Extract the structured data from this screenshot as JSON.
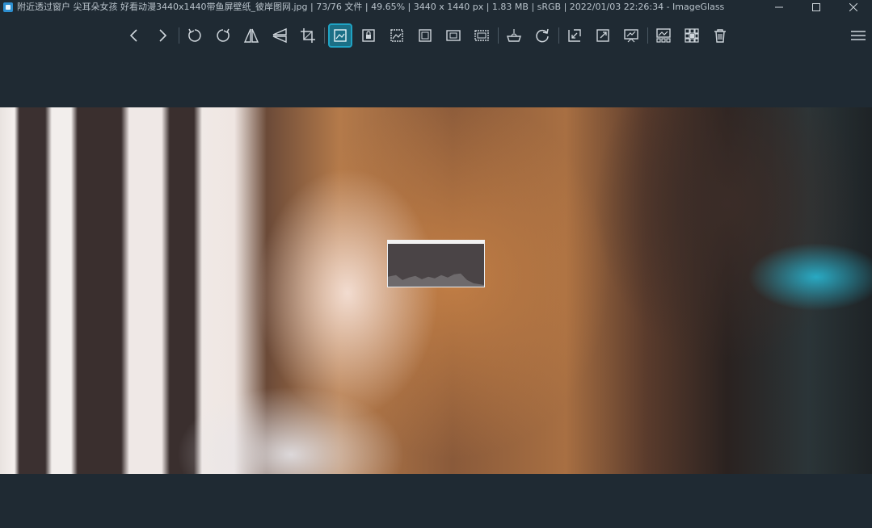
{
  "titlebar": {
    "title": "附近透过窗户 尖耳朵女孩 好看动漫3440x1440带鱼屏壁纸_彼岸图网.jpg  |  73/76 文件  |  49.65%  |  3440 x 1440 px  |  1.83 MB  |  sRGB  |  2022/01/03 22:26:34  - ImageGlass"
  },
  "toolbar": {
    "buttons": [
      {
        "name": "previous-image-button",
        "icon": "chevron-left-icon"
      },
      {
        "name": "next-image-button",
        "icon": "chevron-right-icon"
      },
      {
        "name": "rotate-left-button",
        "icon": "rotate-left-icon"
      },
      {
        "name": "rotate-right-button",
        "icon": "rotate-right-icon"
      },
      {
        "name": "flip-horizontal-button",
        "icon": "flip-horizontal-icon"
      },
      {
        "name": "flip-vertical-button",
        "icon": "flip-vertical-icon"
      },
      {
        "name": "crop-button",
        "icon": "crop-icon"
      },
      {
        "name": "auto-zoom-button",
        "icon": "auto-zoom-icon"
      },
      {
        "name": "lock-zoom-button",
        "icon": "lock-zoom-icon"
      },
      {
        "name": "scale-to-width-button",
        "icon": "scale-width-icon"
      },
      {
        "name": "scale-to-height-button",
        "icon": "scale-height-icon"
      },
      {
        "name": "scale-to-fit-button",
        "icon": "scale-fit-icon"
      },
      {
        "name": "scale-to-fill-button",
        "icon": "scale-fill-icon"
      },
      {
        "name": "open-with-button",
        "icon": "open-with-icon"
      },
      {
        "name": "refresh-button",
        "icon": "refresh-icon"
      },
      {
        "name": "goto-image-button",
        "icon": "goto-icon"
      },
      {
        "name": "fullscreen-button",
        "icon": "fullscreen-icon"
      },
      {
        "name": "slideshow-button",
        "icon": "slideshow-icon"
      },
      {
        "name": "thumbnail-bar-button",
        "icon": "thumbnail-bar-icon"
      },
      {
        "name": "checkerboard-button",
        "icon": "checkerboard-icon"
      },
      {
        "name": "delete-button",
        "icon": "trash-icon"
      },
      {
        "name": "main-menu-button",
        "icon": "hamburger-menu-icon"
      }
    ],
    "active": "auto-zoom-button"
  },
  "colors": {
    "background": "#1f2a33",
    "accent": "#1fa3c4",
    "icon": "#cfd6dc"
  }
}
